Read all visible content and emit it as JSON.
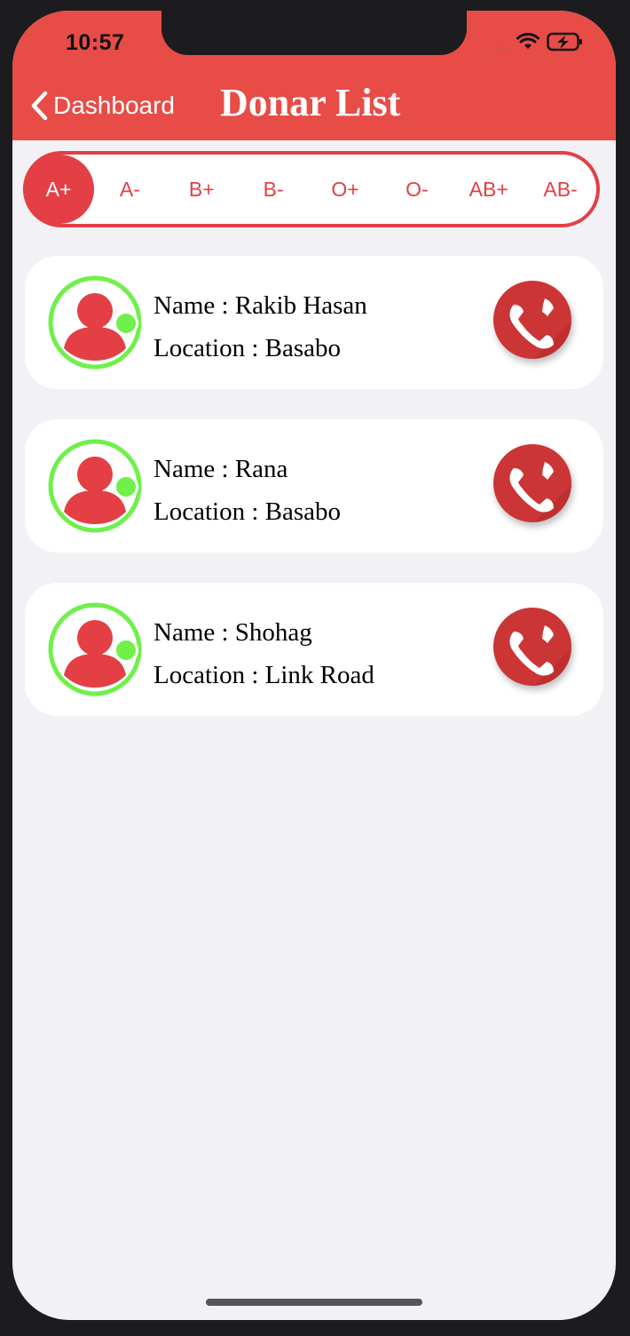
{
  "status_bar": {
    "time": "10:57",
    "signal": "....",
    "wifi_icon": "wifi-icon",
    "battery_icon": "battery-charging-icon"
  },
  "nav": {
    "back_label": "Dashboard",
    "title": "Donar List"
  },
  "blood_groups": [
    "A+",
    "A-",
    "B+",
    "B-",
    "O+",
    "O-",
    "AB+",
    "AB-"
  ],
  "selected_group": "A+",
  "donors": [
    {
      "name_line": "Name : Rakib Hasan",
      "location_line": "Location : Basabo"
    },
    {
      "name_line": "Name : Rana",
      "location_line": "Location : Basabo"
    },
    {
      "name_line": "Name : Shohag",
      "location_line": "Location : Link Road"
    }
  ],
  "colors": {
    "accent": "#e84c47",
    "segment_red": "#e33f45",
    "online_green": "#6ff04a",
    "call_red": "#cb3535",
    "background": "#f1f1f6"
  }
}
